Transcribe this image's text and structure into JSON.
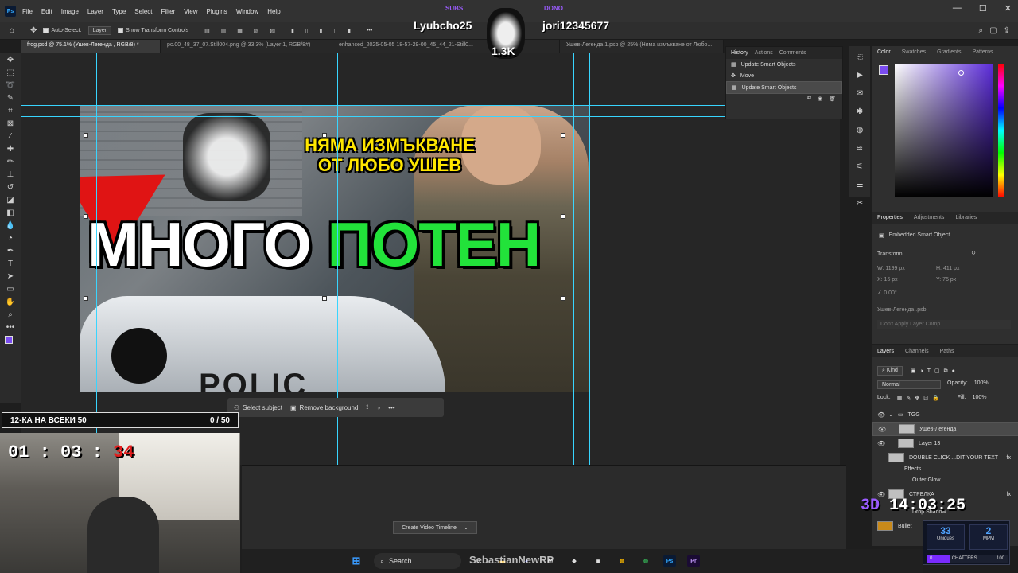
{
  "app": {
    "logo": "Ps"
  },
  "menu": [
    "File",
    "Edit",
    "Image",
    "Layer",
    "Type",
    "Select",
    "Filter",
    "View",
    "Plugins",
    "Window",
    "Help"
  ],
  "window_controls": [
    "—",
    "☐",
    "✕"
  ],
  "options": {
    "auto_select": "Auto-Select:",
    "layer_select": "Layer",
    "transform": "Show Transform Controls"
  },
  "tabs": [
    "frog.psd @ 75.1% (Ушев-Легенда , RGB/8) *",
    "pc.00_48_37_07.Still004.png @ 33.3% (Layer 1, RGB/8#)",
    "enhanced_2025-05-05 18-57-29-00_45_44_21-Still0...",
    "Ушев-Легенда 1.psb @ 25% (Няма измъкване от Любо..."
  ],
  "artwork": {
    "subtitle_line1": "НЯМА ИЗМЪКВАНЕ",
    "subtitle_line2": "ОТ ЛЮБО УШЕВ",
    "title_white": "МНОГО",
    "title_green": "ПОТЕН",
    "car_text": "POLIC"
  },
  "context_bar": {
    "select_subject": "Select subject",
    "remove_background": "Remove background"
  },
  "timeline": {
    "create_button": "Create Video Timeline"
  },
  "history": {
    "tabs": [
      "History",
      "Actions",
      "Comments"
    ],
    "items": [
      "Update Smart Objects",
      "Move",
      "Update Smart Objects"
    ]
  },
  "color_panel": {
    "tabs": [
      "Color",
      "Swatches",
      "Gradients",
      "Patterns"
    ],
    "foreground": "#7a4cf0",
    "background": "#e8911a"
  },
  "properties": {
    "tabs": [
      "Properties",
      "Adjustments",
      "Libraries"
    ],
    "kind": "Embedded Smart Object",
    "section": "Transform",
    "w": "W: 1199 px",
    "h": "H: 411 px",
    "x": "X: 15 px",
    "y": "Y: 75 px",
    "angle": "0.00°",
    "file": "Ушев-Легенда .psb",
    "comp": "Don't Apply Layer Comp"
  },
  "layers": {
    "tabs": [
      "Layers",
      "Channels",
      "Paths"
    ],
    "kind": "Kind",
    "blend": "Normal",
    "opacity_label": "Opacity:",
    "opacity": "100%",
    "lock_label": "Lock:",
    "fill_label": "Fill:",
    "fill": "100%",
    "items": [
      "TGG",
      "Ушев-Легенда",
      "Layer 13",
      "DOUBLE CLICK ...DIT YOUR TEXT",
      "Effects",
      "Outer Glow",
      "СТРЕЛКА",
      "Drop Shadow",
      "Bullet"
    ]
  },
  "stream": {
    "user_left_tag": "SUBS",
    "user_left": "Lyubcho25",
    "user_right_tag": "DONO",
    "user_right": "jori12345677",
    "follower_count": "1.3K",
    "challenge_label": "12-КА НА ВСЕКИ 50",
    "challenge_progress": "0 / 50",
    "challenge_progress_fraction": 0,
    "timer_main": "01 : 03 :",
    "timer_seconds": "34",
    "clock_prefix": "3D",
    "clock": "14:03:25",
    "uniques": "33",
    "uniques_label": "Uniques",
    "mpm": "2",
    "mpm_label": "MPM",
    "chatters_count": "0",
    "chatters_label": "CHATTERS",
    "chatters_goal": "100",
    "chatters_fraction": 0
  },
  "taskbar": {
    "search": "Search",
    "overlay_name": "SebastianNewRP"
  }
}
